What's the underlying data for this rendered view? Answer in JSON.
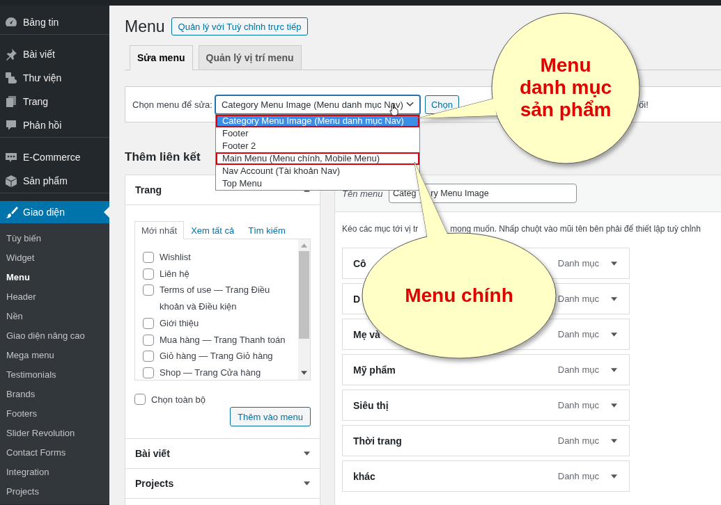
{
  "admin_menu": [
    {
      "label": "Bảng tin",
      "selected": false,
      "separator_after": true
    },
    {
      "label": "Bài viết",
      "selected": false,
      "separator_after": false
    },
    {
      "label": "Thư viện",
      "selected": false,
      "separator_after": false
    },
    {
      "label": "Trang",
      "selected": false,
      "separator_after": false
    },
    {
      "label": "Phản hồi",
      "selected": false,
      "separator_after": true
    },
    {
      "label": "E-Commerce",
      "selected": false,
      "separator_after": false
    },
    {
      "label": "Sản phẩm",
      "selected": false,
      "separator_after": true
    },
    {
      "label": "Giao diện",
      "selected": true,
      "separator_after": false
    }
  ],
  "submenu": [
    {
      "label": "Tùy biến",
      "selected": false
    },
    {
      "label": "Widget",
      "selected": false
    },
    {
      "label": "Menu",
      "selected": true
    },
    {
      "label": "Header",
      "selected": false
    },
    {
      "label": "Nền",
      "selected": false
    },
    {
      "label": "Giao diện nâng cao",
      "selected": false
    },
    {
      "label": "Mega menu",
      "selected": false
    },
    {
      "label": "Testimonials",
      "selected": false
    },
    {
      "label": "Brands",
      "selected": false
    },
    {
      "label": "Footers",
      "selected": false
    },
    {
      "label": "Slider Revolution",
      "selected": false
    },
    {
      "label": "Contact Forms",
      "selected": false
    },
    {
      "label": "Integration",
      "selected": false
    },
    {
      "label": "Projects",
      "selected": false
    }
  ],
  "page": {
    "title": "Menu",
    "action_button": "Quản lý với Tuỳ chỉnh trực tiếp",
    "tabs": [
      {
        "label": "Sửa menu",
        "selected": true
      },
      {
        "label": "Quản lý vị trí menu",
        "selected": false
      }
    ]
  },
  "manage": {
    "label": "Chọn menu để sửa:",
    "select_value": "Category Menu Image (Menu danh mục Nav)",
    "open": true,
    "options": [
      {
        "label": "Category Menu Image (Menu danh mục Nav)",
        "selected": true,
        "outlined": true
      },
      {
        "label": "Footer",
        "selected": false,
        "outlined": false
      },
      {
        "label": "Footer 2",
        "selected": false,
        "outlined": false
      },
      {
        "label": "Main Menu (Menu chính, Mobile Menu)",
        "selected": false,
        "outlined": true
      },
      {
        "label": "Nav Account (Tài khoản Nav)",
        "selected": false,
        "outlined": false
      },
      {
        "label": "Top Menu",
        "selected": false,
        "outlined": false
      }
    ],
    "button": "Chọn",
    "trailing_text": "ối!"
  },
  "add_links": {
    "heading": "Thêm liên kết",
    "panels": [
      {
        "title": "Trang",
        "expanded": true,
        "tabs": [
          {
            "label": "Mới nhất",
            "selected": true
          },
          {
            "label": "Xem tất cả",
            "selected": false
          },
          {
            "label": "Tìm kiếm",
            "selected": false
          }
        ],
        "items": [
          {
            "label": "Wishlist",
            "checked": false
          },
          {
            "label": "Liên hệ",
            "checked": false
          },
          {
            "label": "Terms of use — Trang Điều khoản và Điều kiện",
            "checked": false
          },
          {
            "label": "Giới thiệu",
            "checked": false
          },
          {
            "label": "Mua hàng — Trang Thanh toán",
            "checked": false
          },
          {
            "label": "Giỏ hàng — Trang Giỏ hàng",
            "checked": false
          },
          {
            "label": "Shop — Trang Cửa hàng",
            "checked": false
          }
        ],
        "select_all": {
          "label": "Chọn toàn bộ",
          "checked": false
        },
        "button": "Thêm vào menu"
      },
      {
        "title": "Bài viết",
        "expanded": false
      },
      {
        "title": "Projects",
        "expanded": false
      }
    ]
  },
  "structure": {
    "name_label": "Tên menu",
    "name_value_parts": [
      "Categ",
      "ry Menu Image"
    ],
    "instruction_parts": [
      "Kéo các mục tới vị tr",
      "mong muốn. Nhấp chuột vào mũi tên bên phải để thiết lập tuỳ chỉnh"
    ],
    "items": [
      {
        "title": "Cô",
        "type": "Danh mục"
      },
      {
        "title": "D",
        "type": "Danh mục"
      },
      {
        "title": "Mẹ và",
        "type": "Danh mục"
      },
      {
        "title": "Mỹ phẩm",
        "type": "Danh mục"
      },
      {
        "title": "Siêu thị",
        "type": "Danh mục"
      },
      {
        "title": "Thời trang",
        "type": "Danh mục"
      },
      {
        "title": "khác",
        "type": "Danh mục"
      }
    ]
  },
  "callouts": [
    {
      "kind": "circle",
      "text": "Menu\ndanh mục\nsản phẩm"
    },
    {
      "kind": "ellipse",
      "text": "Menu chính"
    }
  ]
}
